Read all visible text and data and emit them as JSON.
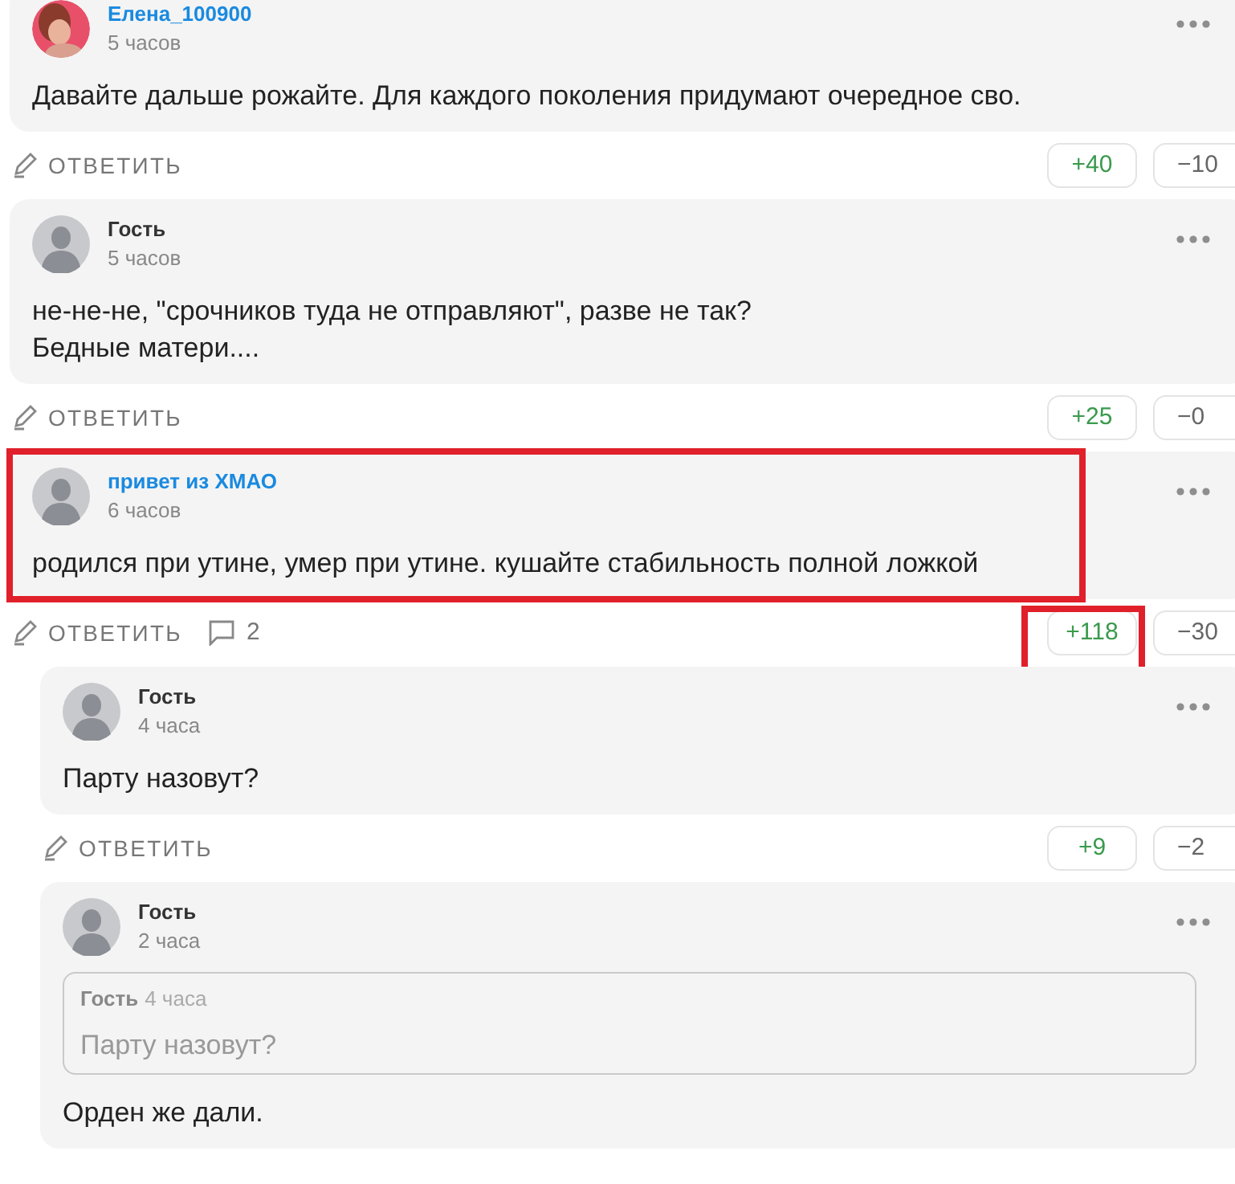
{
  "comments": [
    {
      "author": "Елена_100900",
      "author_link": true,
      "time": "5 часов",
      "text": "Давайте дальше рожайте. Для каждого поколения придумают очередное сво.",
      "highlighted": false,
      "reply_label": "ОТВЕТИТЬ",
      "upvotes": "+40",
      "upvotes_highlighted": false,
      "downvotes": "−10"
    },
    {
      "author": "Гость",
      "author_link": false,
      "avatar": {
        "kind": "silhouette"
      },
      "time": "5 часов",
      "text": "не-не-не, \"срочников туда не отправляют\", разве не так?\nБедные матери....",
      "highlighted": false,
      "reply_label": "ОТВЕТИТЬ",
      "upvotes": "+25",
      "upvotes_highlighted": false,
      "downvotes": "−0"
    },
    {
      "author": "привет из ХМАО",
      "author_link": true,
      "avatar": {
        "kind": "silhouette"
      },
      "time": "6 часов",
      "text": "родился при утине, умер при утине. кушайте стабильность полной ложкой",
      "highlighted": true,
      "reply_label": "ОТВЕТИТЬ",
      "reply_count": "2",
      "upvotes": "+118",
      "upvotes_highlighted": true,
      "downvotes": "−30",
      "children": [
        {
          "author": "Гость",
          "author_link": false,
          "avatar": {
            "kind": "silhouette"
          },
          "time": "4 часа",
          "text": "Парту назовут?",
          "highlighted": false,
          "reply_label": "ОТВЕТИТЬ",
          "upvotes": "+9",
          "upvotes_highlighted": false,
          "downvotes": "−2"
        },
        {
          "author": "Гость",
          "author_link": false,
          "avatar": {
            "kind": "silhouette"
          },
          "time": "2 часа",
          "quote": {
            "author": "Гость",
            "time": "4 часа",
            "text": "Парту назовут?"
          },
          "text": "Орден же дали.",
          "highlighted": false
        }
      ]
    }
  ]
}
